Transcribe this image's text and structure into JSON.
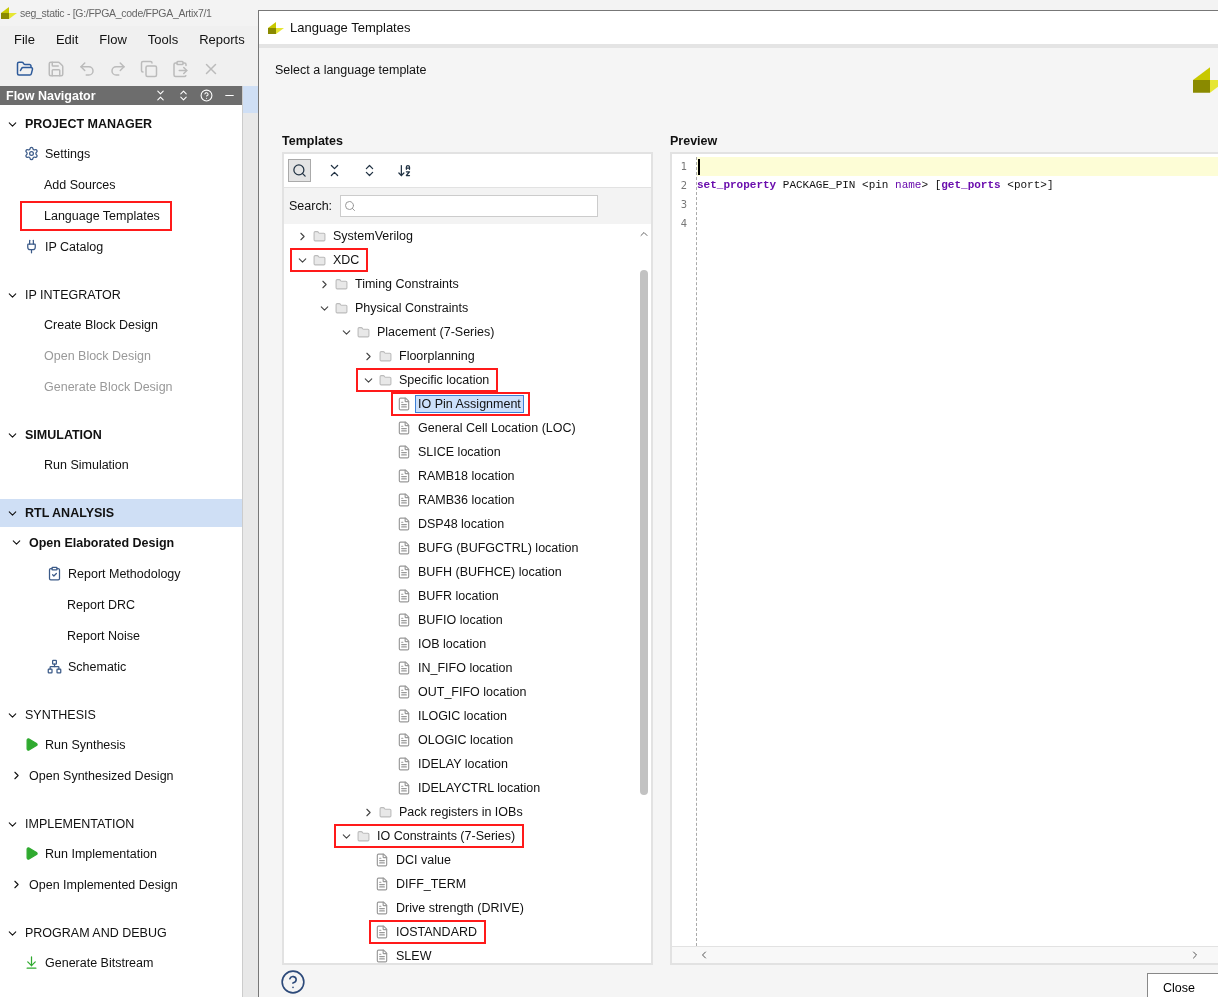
{
  "main_window": {
    "title": "seg_static - [G:/FPGA_code/FPGA_Artix7/1",
    "menu": [
      {
        "label": "File"
      },
      {
        "label": "Edit"
      },
      {
        "label": "Flow"
      },
      {
        "label": "Tools"
      },
      {
        "label": "Reports"
      }
    ],
    "toolbar": [
      {
        "kind": "open",
        "disabled": false
      },
      {
        "kind": "save",
        "disabled": true
      },
      {
        "kind": "undo",
        "disabled": true
      },
      {
        "kind": "redo",
        "disabled": true
      },
      {
        "kind": "copy",
        "disabled": true
      },
      {
        "kind": "paste",
        "disabled": true
      },
      {
        "kind": "delete",
        "disabled": true
      }
    ]
  },
  "flow_navigator": {
    "title": "Flow Navigator",
    "sections": [
      {
        "label": "PROJECT MANAGER",
        "expanded": true,
        "emphasized": true,
        "selected": false,
        "items": [
          {
            "label": "Settings",
            "kind": "gear",
            "disabled": false,
            "annotated": false
          },
          {
            "label": "Add Sources",
            "kind": "plain",
            "disabled": false,
            "annotated": false
          },
          {
            "label": "Language Templates",
            "kind": "plain",
            "disabled": false,
            "annotated": true
          },
          {
            "label": "IP Catalog",
            "kind": "plug",
            "disabled": false,
            "annotated": false
          }
        ]
      },
      {
        "label": "IP INTEGRATOR",
        "expanded": true,
        "emphasized": false,
        "selected": false,
        "items": [
          {
            "label": "Create Block Design",
            "kind": "plain",
            "disabled": false,
            "annotated": false
          },
          {
            "label": "Open Block Design",
            "kind": "plain",
            "disabled": true,
            "annotated": false
          },
          {
            "label": "Generate Block Design",
            "kind": "plain",
            "disabled": true,
            "annotated": false
          }
        ]
      },
      {
        "label": "SIMULATION",
        "expanded": true,
        "emphasized": true,
        "selected": false,
        "items": [
          {
            "label": "Run Simulation",
            "kind": "plain",
            "disabled": false,
            "annotated": false
          }
        ]
      },
      {
        "label": "RTL ANALYSIS",
        "expanded": true,
        "emphasized": true,
        "selected": true,
        "items": [
          {
            "label": "Open Elaborated Design",
            "kind": "group",
            "disabled": false,
            "annotated": false,
            "expanded": true,
            "children": [
              {
                "label": "Report Methodology",
                "kind": "report",
                "disabled": false,
                "annotated": false
              },
              {
                "label": "Report DRC",
                "kind": "plain",
                "disabled": false,
                "annotated": false
              },
              {
                "label": "Report Noise",
                "kind": "plain",
                "disabled": false,
                "annotated": false
              },
              {
                "label": "Schematic",
                "kind": "schematic",
                "disabled": false,
                "annotated": false
              }
            ]
          }
        ]
      },
      {
        "label": "SYNTHESIS",
        "expanded": true,
        "emphasized": false,
        "selected": false,
        "items": [
          {
            "label": "Run Synthesis",
            "kind": "run",
            "disabled": false,
            "annotated": false
          },
          {
            "label": "Open Synthesized Design",
            "kind": "group",
            "disabled": false,
            "annotated": false,
            "expanded": false
          }
        ]
      },
      {
        "label": "IMPLEMENTATION",
        "expanded": true,
        "emphasized": false,
        "selected": false,
        "items": [
          {
            "label": "Run Implementation",
            "kind": "run",
            "disabled": false,
            "annotated": false
          },
          {
            "label": "Open Implemented Design",
            "kind": "group",
            "disabled": false,
            "annotated": false,
            "expanded": false
          }
        ]
      },
      {
        "label": "PROGRAM AND DEBUG",
        "expanded": true,
        "emphasized": false,
        "selected": false,
        "items": [
          {
            "label": "Generate Bitstream",
            "kind": "bitstream",
            "disabled": false,
            "annotated": false
          }
        ]
      }
    ]
  },
  "dialog": {
    "title": "Language Templates",
    "instruction": "Select a language template",
    "templates": {
      "label": "Templates",
      "search": {
        "label": "Search:"
      },
      "tree": [
        {
          "label": "SystemVerilog",
          "kind": "folder",
          "expanded": false,
          "selected": false,
          "annotated": false
        },
        {
          "label": "XDC",
          "kind": "folder",
          "expanded": true,
          "selected": false,
          "annotated": true,
          "children": [
            {
              "label": "Timing Constraints",
              "kind": "folder",
              "expanded": false,
              "selected": false,
              "annotated": false
            },
            {
              "label": "Physical Constraints",
              "kind": "folder",
              "expanded": true,
              "selected": false,
              "annotated": false,
              "children": [
                {
                  "label": "Placement (7-Series)",
                  "kind": "folder",
                  "expanded": true,
                  "selected": false,
                  "annotated": false,
                  "children": [
                    {
                      "label": "Floorplanning",
                      "kind": "folder",
                      "expanded": false,
                      "selected": false,
                      "annotated": false
                    },
                    {
                      "label": "Specific location",
                      "kind": "folder",
                      "expanded": true,
                      "selected": false,
                      "annotated": true,
                      "children": [
                        {
                          "label": "IO Pin Assignment",
                          "kind": "file",
                          "selected": true,
                          "annotated": true
                        },
                        {
                          "label": "General Cell Location (LOC)",
                          "kind": "file",
                          "selected": false,
                          "annotated": false
                        },
                        {
                          "label": "SLICE location",
                          "kind": "file",
                          "selected": false,
                          "annotated": false
                        },
                        {
                          "label": "RAMB18 location",
                          "kind": "file",
                          "selected": false,
                          "annotated": false
                        },
                        {
                          "label": "RAMB36 location",
                          "kind": "file",
                          "selected": false,
                          "annotated": false
                        },
                        {
                          "label": "DSP48 location",
                          "kind": "file",
                          "selected": false,
                          "annotated": false
                        },
                        {
                          "label": "BUFG (BUFGCTRL) location",
                          "kind": "file",
                          "selected": false,
                          "annotated": false
                        },
                        {
                          "label": "BUFH (BUFHCE) location",
                          "kind": "file",
                          "selected": false,
                          "annotated": false
                        },
                        {
                          "label": "BUFR location",
                          "kind": "file",
                          "selected": false,
                          "annotated": false
                        },
                        {
                          "label": "BUFIO location",
                          "kind": "file",
                          "selected": false,
                          "annotated": false
                        },
                        {
                          "label": "IOB location",
                          "kind": "file",
                          "selected": false,
                          "annotated": false
                        },
                        {
                          "label": "IN_FIFO location",
                          "kind": "file",
                          "selected": false,
                          "annotated": false
                        },
                        {
                          "label": "OUT_FIFO location",
                          "kind": "file",
                          "selected": false,
                          "annotated": false
                        },
                        {
                          "label": "ILOGIC location",
                          "kind": "file",
                          "selected": false,
                          "annotated": false
                        },
                        {
                          "label": "OLOGIC location",
                          "kind": "file",
                          "selected": false,
                          "annotated": false
                        },
                        {
                          "label": "IDELAY location",
                          "kind": "file",
                          "selected": false,
                          "annotated": false
                        },
                        {
                          "label": "IDELAYCTRL location",
                          "kind": "file",
                          "selected": false,
                          "annotated": false
                        }
                      ]
                    },
                    {
                      "label": "Pack registers in IOBs",
                      "kind": "folder",
                      "expanded": false,
                      "selected": false,
                      "annotated": false
                    }
                  ]
                },
                {
                  "label": "IO Constraints (7-Series)",
                  "kind": "folder",
                  "expanded": true,
                  "selected": false,
                  "annotated": true,
                  "children": [
                    {
                      "label": "DCI value",
                      "kind": "file",
                      "selected": false,
                      "annotated": false
                    },
                    {
                      "label": "DIFF_TERM",
                      "kind": "file",
                      "selected": false,
                      "annotated": false
                    },
                    {
                      "label": "Drive strength (DRIVE)",
                      "kind": "file",
                      "selected": false,
                      "annotated": false
                    },
                    {
                      "label": "IOSTANDARD",
                      "kind": "file",
                      "selected": false,
                      "annotated": true
                    },
                    {
                      "label": "SLEW",
                      "kind": "file",
                      "selected": false,
                      "annotated": false
                    }
                  ]
                }
              ]
            }
          ]
        }
      ]
    },
    "preview": {
      "label": "Preview",
      "lines": [
        {
          "number": "1",
          "current": true
        },
        {
          "number": "2",
          "current": false,
          "tokens": [
            {
              "text": "set_property",
              "kind": "keyword"
            },
            {
              "text": " PACKAGE_PIN <pin ",
              "kind": "plain"
            },
            {
              "text": "name",
              "kind": "name"
            },
            {
              "text": "> [",
              "kind": "plain"
            },
            {
              "text": "get_ports",
              "kind": "keyword"
            },
            {
              "text": " <port>]",
              "kind": "plain"
            }
          ]
        },
        {
          "number": "3",
          "current": false
        },
        {
          "number": "4",
          "current": false
        }
      ]
    },
    "buttons": [
      {
        "label": "Close"
      }
    ]
  }
}
